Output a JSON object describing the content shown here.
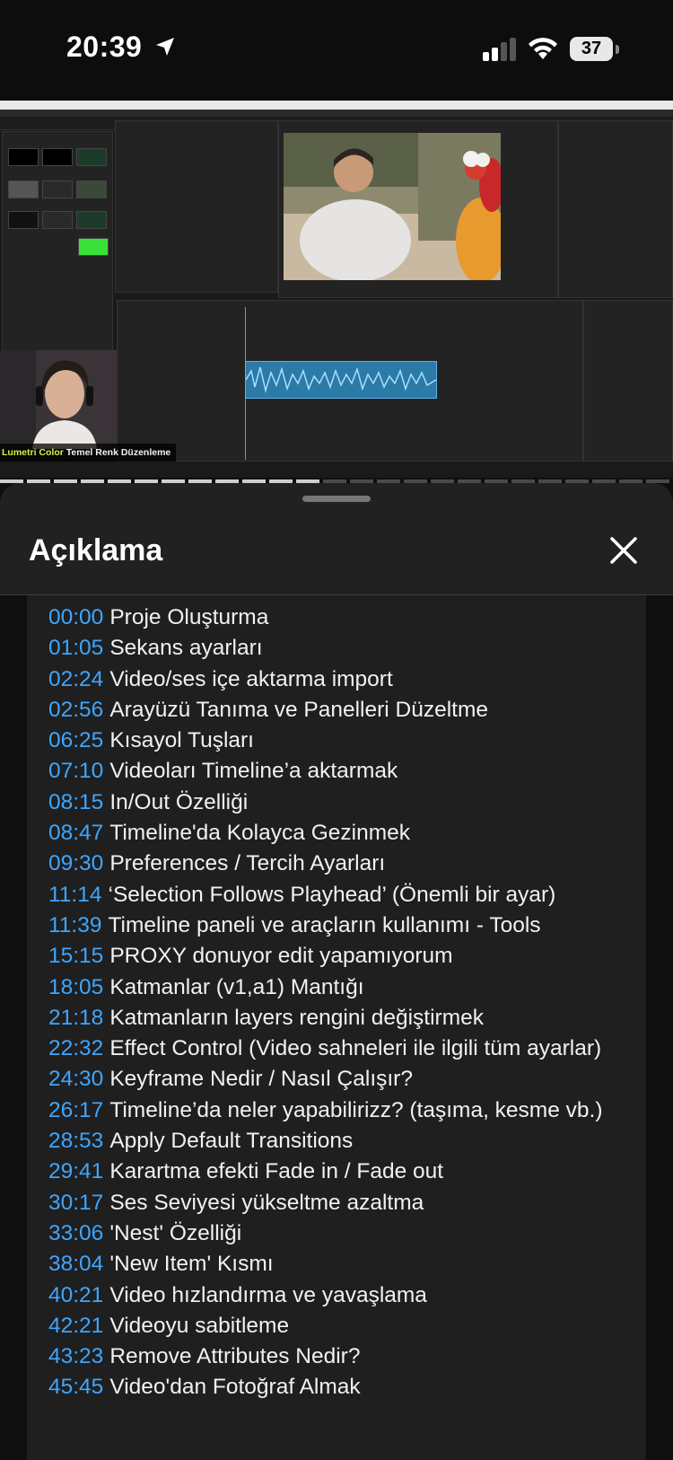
{
  "status_bar": {
    "time": "20:39",
    "battery": "37"
  },
  "video": {
    "caption_highlight": "Lumetri Color",
    "caption_rest": "Temel Renk Düzenleme"
  },
  "sheet": {
    "title": "Açıklama"
  },
  "chapters": [
    {
      "time": "00:00",
      "title": "Proje Oluşturma"
    },
    {
      "time": "01:05",
      "title": "Sekans ayarları"
    },
    {
      "time": "02:24",
      "title": "Video/ses içe aktarma import"
    },
    {
      "time": "02:56",
      "title": "Arayüzü Tanıma ve Panelleri Düzeltme"
    },
    {
      "time": "06:25",
      "title": "Kısayol Tuşları"
    },
    {
      "time": "07:10",
      "title": "Videoları Timeline’a aktarmak"
    },
    {
      "time": "08:15",
      "title": "In/Out Özelliği"
    },
    {
      "time": "08:47",
      "title": "Timeline'da Kolayca Gezinmek"
    },
    {
      "time": "09:30",
      "title": "Preferences / Tercih Ayarları"
    },
    {
      "time": "11:14",
      "title": "‘Selection Follows Playhead’ (Önemli bir ayar)"
    },
    {
      "time": "11:39",
      "title": "Timeline paneli ve araçların kullanımı - Tools"
    },
    {
      "time": "15:15",
      "title": "PROXY donuyor edit yapamıyorum"
    },
    {
      "time": "18:05",
      "title": "Katmanlar (v1,a1) Mantığı"
    },
    {
      "time": "21:18",
      "title": "Katmanların layers rengini değiştirmek"
    },
    {
      "time": "22:32",
      "title": "Effect Control (Video sahneleri ile ilgili tüm ayarlar)"
    },
    {
      "time": "24:30",
      "title": "Keyframe Nedir / Nasıl Çalışır?"
    },
    {
      "time": "26:17",
      "title": "Timeline’da neler yapabilirizz? (taşıma, kesme vb.)"
    },
    {
      "time": "28:53",
      "title": "Apply Default Transitions"
    },
    {
      "time": "29:41",
      "title": "Karartma efekti Fade in / Fade out"
    },
    {
      "time": "30:17",
      "title": "Ses Seviyesi yükseltme azaltma"
    },
    {
      "time": "33:06",
      "title": "'Nest' Özelliği"
    },
    {
      "time": "38:04",
      "title": "'New Item' Kısmı"
    },
    {
      "time": "40:21",
      "title": "Video hızlandırma ve yavaşlama"
    },
    {
      "time": "42:21",
      "title": "Videoyu sabitleme"
    },
    {
      "time": "43:23",
      "title": "Remove Attributes Nedir?"
    },
    {
      "time": "45:45",
      "title": "Video'dan Fotoğraf Almak"
    }
  ]
}
